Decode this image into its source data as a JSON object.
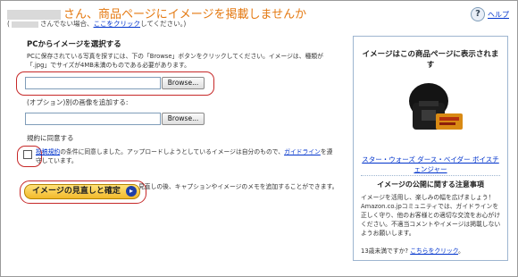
{
  "header": {
    "title_suffix": "さん、商品ページにイメージを掲載しませんか",
    "subtitle_prefix": "(",
    "subtitle_middle": "さんでない場合、",
    "subtitle_link": "ここをクリック",
    "subtitle_suffix": "してください。)",
    "help_label": "ヘルプ"
  },
  "upload": {
    "heading": "PCからイメージを選択する",
    "instructions": "PCに保存されている写真を探すには、下の「Browse」ボタンをクリックしてください。イメージは、種類が「.jpg」でサイズが4MB未満のものである必要があります。",
    "browse_label": "Browse...",
    "file_value": "",
    "optional_heading": "(オプション)別の画像を追加する:",
    "optional_value": "",
    "optional_browse_label": "Browse..."
  },
  "agreement": {
    "heading": "規約に同意する",
    "link1": "投稿規約",
    "text1": "の条件に同意しました。アップロードしようとしているイメージは自分のもので、",
    "link2": "ガイドライン",
    "text2": "を遵守しています。"
  },
  "confirm": {
    "button_label": "イメージの見直しと確定",
    "note": "見直しの後、キャプションやイメージのメモを追加することができます。"
  },
  "sidebar": {
    "title": "イメージはこの商品ページに表示されます",
    "product_link": "スター・ウォーズ ダース・ベイダー ボイスチェンジャー",
    "rules_heading": "イメージの公開に関する注意事項",
    "rules_text": "イメージを活用し、楽しみの幅を広げましょう！Amazon.co.jpコミュニティでは、ガイドラインを正しく守り、他のお客様との適切な交流をお心がけください。不適当コメントやイメージは掲載しないようお願いします。",
    "age_prefix": "13歳未満ですか? ",
    "age_link": "こちらをクリック",
    "age_suffix": "。"
  },
  "colors": {
    "title": "#e47911",
    "link": "#0033cc",
    "highlight_ring": "#c62828",
    "confirm_button": "#f2b92b"
  }
}
